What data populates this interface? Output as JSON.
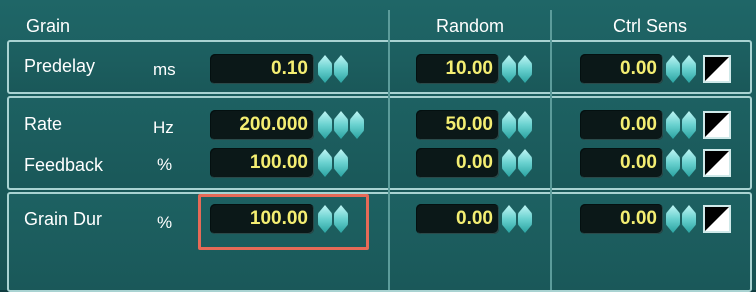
{
  "header": {
    "title": "Grain",
    "random": "Random",
    "ctrl_sens": "Ctrl Sens"
  },
  "rows": {
    "predelay": {
      "label": "Predelay",
      "unit": "ms",
      "value": "0.10",
      "random": "10.00",
      "ctrl": "0.00"
    },
    "rate": {
      "label": "Rate",
      "unit": "Hz",
      "value": "200.000",
      "random": "50.00",
      "ctrl": "0.00"
    },
    "feedback": {
      "label": "Feedback",
      "unit": "%",
      "value": "100.00",
      "random": "0.00",
      "ctrl": "0.00"
    },
    "grain_dur": {
      "label": "Grain Dur",
      "unit": "%",
      "value": "100.00",
      "random": "0.00",
      "ctrl": "0.00"
    }
  },
  "colors": {
    "background": "#1a5b5c",
    "value_text": "#f4ee72",
    "highlight": "#e66a57"
  }
}
